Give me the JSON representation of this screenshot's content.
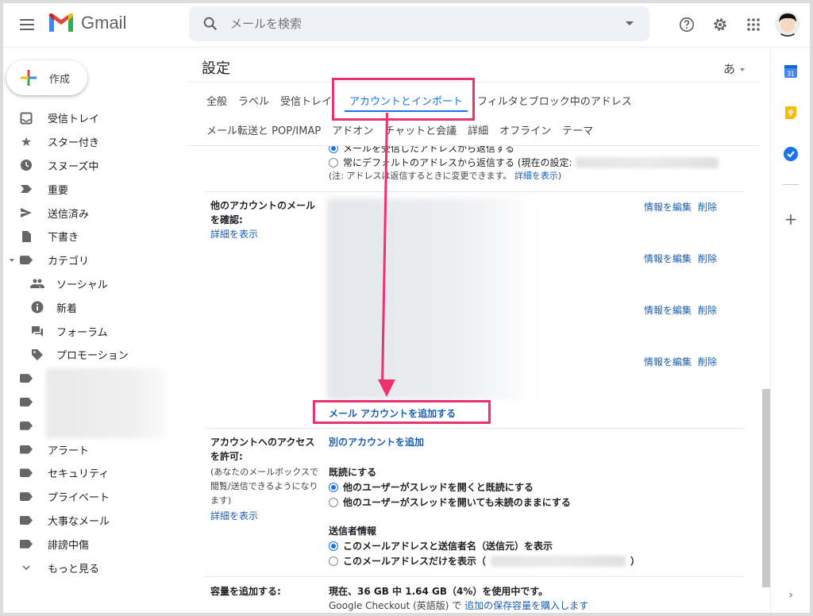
{
  "header": {
    "app_name": "Gmail",
    "search_placeholder": "メールを検索"
  },
  "sidebar": {
    "compose_label": "作成",
    "items": [
      {
        "label": "受信トレイ",
        "icon": "inbox-icon"
      },
      {
        "label": "スター付き",
        "icon": "star-icon"
      },
      {
        "label": "スヌーズ中",
        "icon": "clock-icon"
      },
      {
        "label": "重要",
        "icon": "important-icon"
      },
      {
        "label": "送信済み",
        "icon": "send-icon"
      },
      {
        "label": "下書き",
        "icon": "draft-icon"
      },
      {
        "label": "カテゴリ",
        "icon": "label-icon"
      }
    ],
    "categories": [
      {
        "label": "ソーシャル",
        "icon": "people-icon"
      },
      {
        "label": "新着",
        "icon": "info-icon"
      },
      {
        "label": "フォーラム",
        "icon": "forum-icon"
      },
      {
        "label": "プロモーション",
        "icon": "tag-icon"
      }
    ],
    "labels": [
      {
        "label": "アラート"
      },
      {
        "label": "セキュリティ"
      },
      {
        "label": "プライベート"
      },
      {
        "label": "大事なメール"
      },
      {
        "label": "誹謗中傷"
      }
    ],
    "more_label": "もっと見る"
  },
  "settings": {
    "title": "設定",
    "ime_label": "あ",
    "tabs_row1": [
      "全般",
      "ラベル",
      "受信トレイ",
      "アカウントとインポート",
      "フィルタとブロック中のアドレス"
    ],
    "tabs_row2": [
      "メール転送と POP/IMAP",
      "アドオン",
      "チャットと会議",
      "詳細",
      "オフライン",
      "テーマ"
    ],
    "active_tab": "アカウントとインポート",
    "reply": {
      "option1": "メールを受信したアドレスから返信する",
      "option2": "常にデフォルトのアドレスから返信する (現在の設定:",
      "note_prefix": "(注: アドレスは返信するときに変更できます。",
      "note_link": "詳細を表示",
      "note_suffix": ")"
    },
    "check_mail": {
      "label_line1": "他のアカウントのメール",
      "label_line2": "を確認:",
      "learn_more": "詳細を表示",
      "accounts": [
        {
          "edit": "情報を編集",
          "delete": "削除"
        },
        {
          "edit": "情報を編集",
          "delete": "削除"
        },
        {
          "edit": "情報を編集",
          "delete": "削除"
        },
        {
          "edit": "情報を編集",
          "delete": "削除"
        }
      ],
      "add_account": "メール アカウントを追加する"
    },
    "grant_access": {
      "label_line1": "アカウントへのアクセス",
      "label_line2": "を許可:",
      "desc_line1": "(あなたのメールボックスで",
      "desc_line2": "閲覧/送信できるようになり",
      "desc_line3": "ます)",
      "learn_more": "詳細を表示",
      "add_another": "別のアカウントを追加",
      "mark_read_title": "既読にする",
      "mark_read_opt1": "他のユーザーがスレッドを開くと既読にする",
      "mark_read_opt2": "他のユーザーがスレッドを開いても未読のままにする",
      "sender_info_title": "送信者情報",
      "sender_opt1": "このメールアドレスと送信者名（送信元）を表示",
      "sender_opt2_prefix": "このメールアドレスだけを表示（",
      "sender_opt2_suffix": "）"
    },
    "storage": {
      "label": "容量を追加する:",
      "usage": "現在、36 GB 中 1.64 GB（4%）を使用中です。",
      "checkout_prefix": "Google Checkout (英語版) で",
      "checkout_link": "追加の保存容量を購入します"
    }
  },
  "right_panel": {
    "calendar_day": "31"
  }
}
